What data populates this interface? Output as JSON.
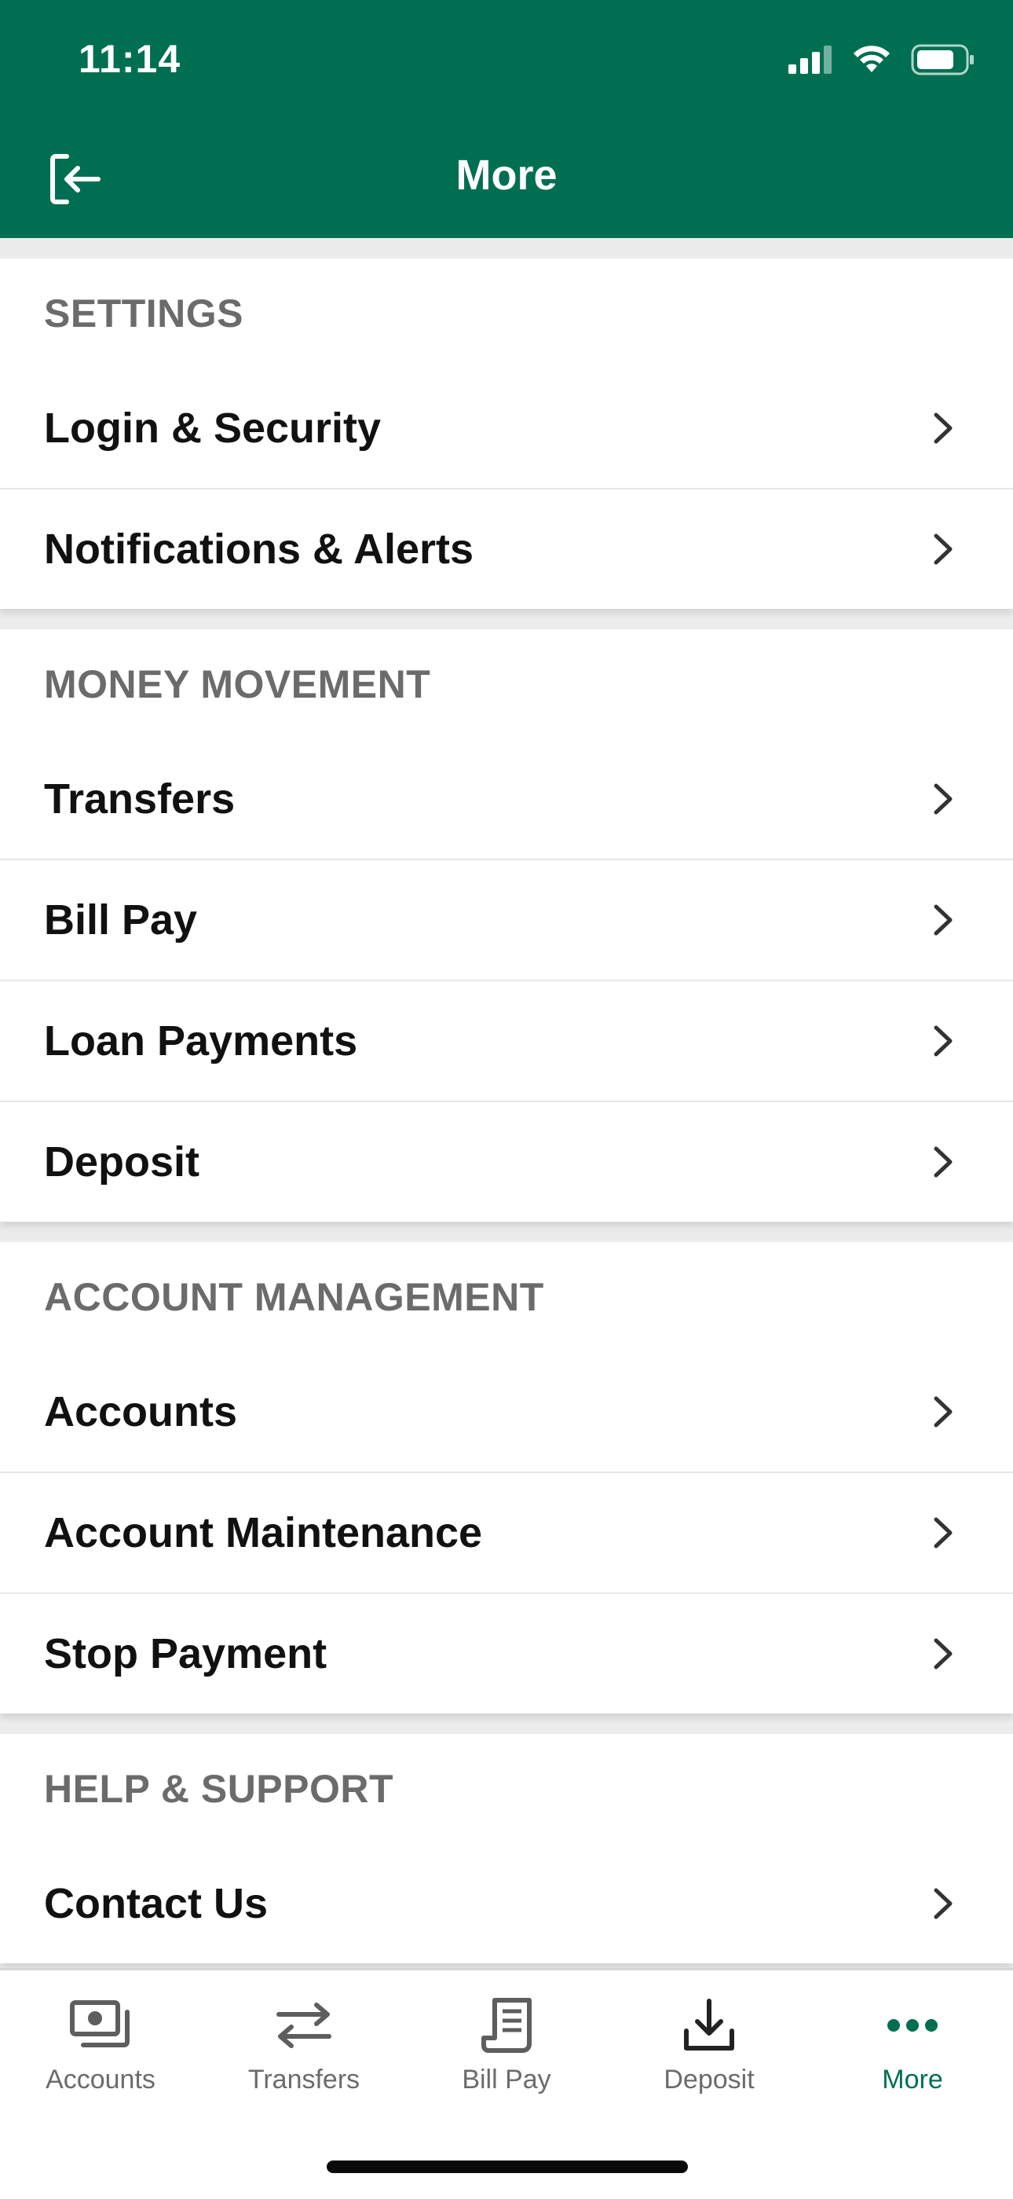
{
  "status_bar": {
    "time": "11:14"
  },
  "nav": {
    "title": "More",
    "logout_icon": "logout-icon"
  },
  "sections": [
    {
      "header": "SETTINGS",
      "items": [
        "Login & Security",
        "Notifications & Alerts"
      ]
    },
    {
      "header": "MONEY MOVEMENT",
      "items": [
        "Transfers",
        "Bill Pay",
        "Loan Payments",
        "Deposit"
      ]
    },
    {
      "header": "ACCOUNT MANAGEMENT",
      "items": [
        "Accounts",
        "Account Maintenance",
        "Stop Payment"
      ]
    },
    {
      "header": "HELP & SUPPORT",
      "items": [
        "Contact Us"
      ]
    }
  ],
  "tabbar": {
    "tabs": [
      {
        "label": "Accounts",
        "icon": "accounts-icon"
      },
      {
        "label": "Transfers",
        "icon": "transfers-icon"
      },
      {
        "label": "Bill Pay",
        "icon": "bill-pay-icon"
      },
      {
        "label": "Deposit",
        "icon": "deposit-icon"
      },
      {
        "label": "More",
        "icon": "more-icon"
      }
    ],
    "active": "More"
  },
  "colors": {
    "brand_green": "#006f51",
    "section_header_gray": "#6b6b6b",
    "row_text": "#111111"
  }
}
